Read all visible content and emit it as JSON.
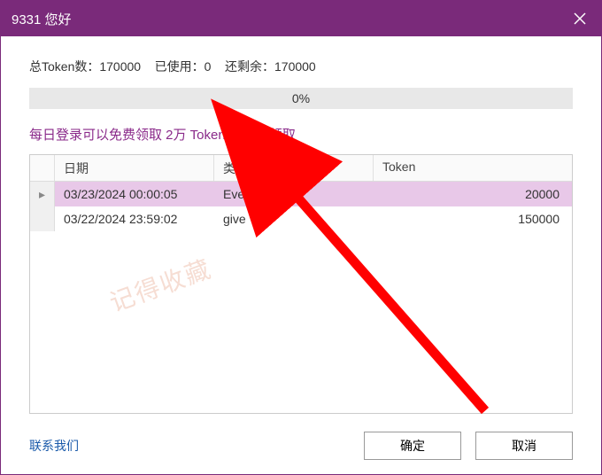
{
  "titlebar": {
    "title": "9331 您好"
  },
  "stats": {
    "total_label": "总Token数：",
    "total_value": "170000",
    "used_label": "已使用：",
    "used_value": "0",
    "remain_label": "还剩余：",
    "remain_value": "170000"
  },
  "progress": {
    "percent_text": "0%"
  },
  "claim_link_text": "每日登录可以免费领取 2万 Token ，点击领取",
  "table": {
    "headers": {
      "date": "日期",
      "type": "类别",
      "token": "Token"
    },
    "rows": [
      {
        "date": "03/23/2024 00:00:05",
        "type": "EveryDay",
        "token": "20000",
        "selected": true,
        "pointer": "▸"
      },
      {
        "date": "03/22/2024 23:59:02",
        "type": "give",
        "token": "150000",
        "selected": false,
        "pointer": ""
      }
    ]
  },
  "footer": {
    "contact": "联系我们",
    "ok": "确定",
    "cancel": "取消"
  },
  "watermark_text": "记得收藏"
}
